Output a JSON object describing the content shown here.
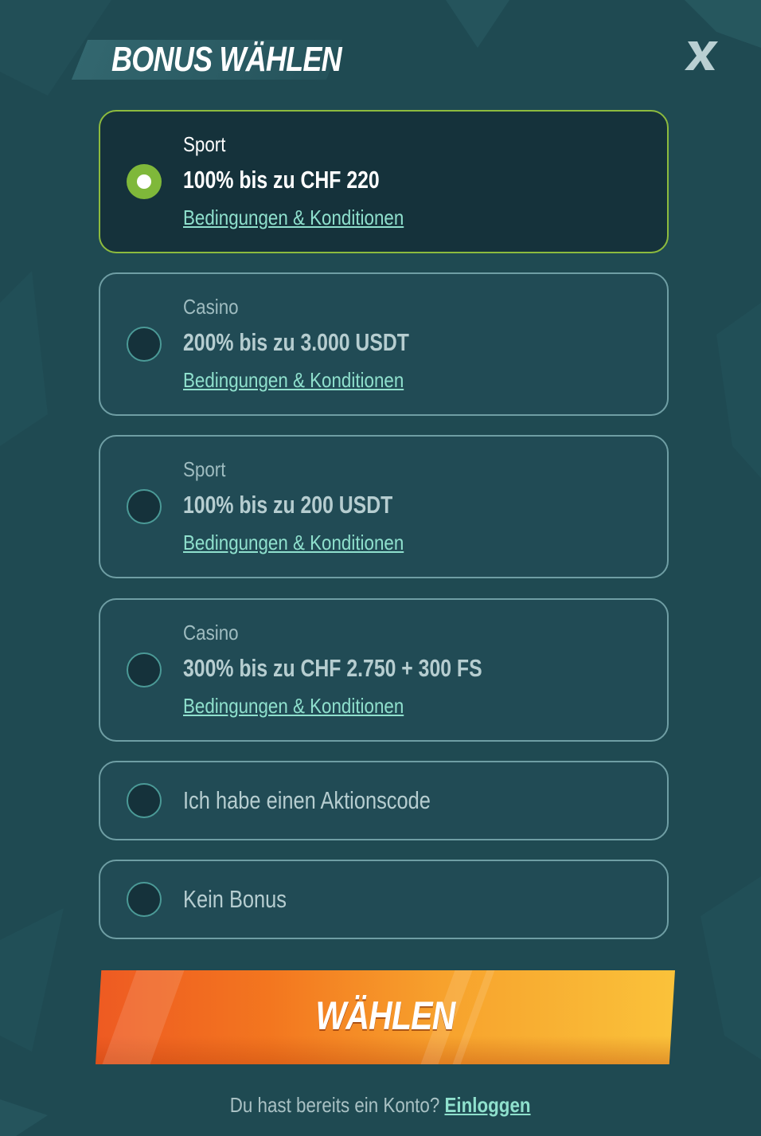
{
  "header": {
    "title": "BONUS WÄHLEN",
    "close_icon": "close-x-icon"
  },
  "options": [
    {
      "category": "Sport",
      "offer": "100% bis zu CHF 220",
      "terms_link": "Bedingungen & Konditionen",
      "selected": true
    },
    {
      "category": "Casino",
      "offer": "200% bis zu 3.000 USDT",
      "terms_link": "Bedingungen & Konditionen",
      "selected": false
    },
    {
      "category": "Sport",
      "offer": "100% bis zu 200 USDT",
      "terms_link": "Bedingungen & Konditionen",
      "selected": false
    },
    {
      "category": "Casino",
      "offer": "300% bis zu CHF 2.750 + 300 FS",
      "terms_link": "Bedingungen & Konditionen",
      "selected": false
    }
  ],
  "promo_code_option": {
    "label": "Ich habe einen Aktionscode",
    "selected": false
  },
  "no_bonus_option": {
    "label": "Kein Bonus",
    "selected": false
  },
  "cta": {
    "label": "WÄHLEN"
  },
  "footer": {
    "text": "Du hast bereits ein Konto?",
    "login_link": "Einloggen"
  },
  "colors": {
    "background": "#1f4a52",
    "card_border": "#6f9ea4",
    "selected_border": "#8dbb3e",
    "selected_radio": "#7fb83a",
    "link": "#8fe0cd",
    "cta_start": "#ee5a22",
    "cta_end": "#fac23a"
  }
}
